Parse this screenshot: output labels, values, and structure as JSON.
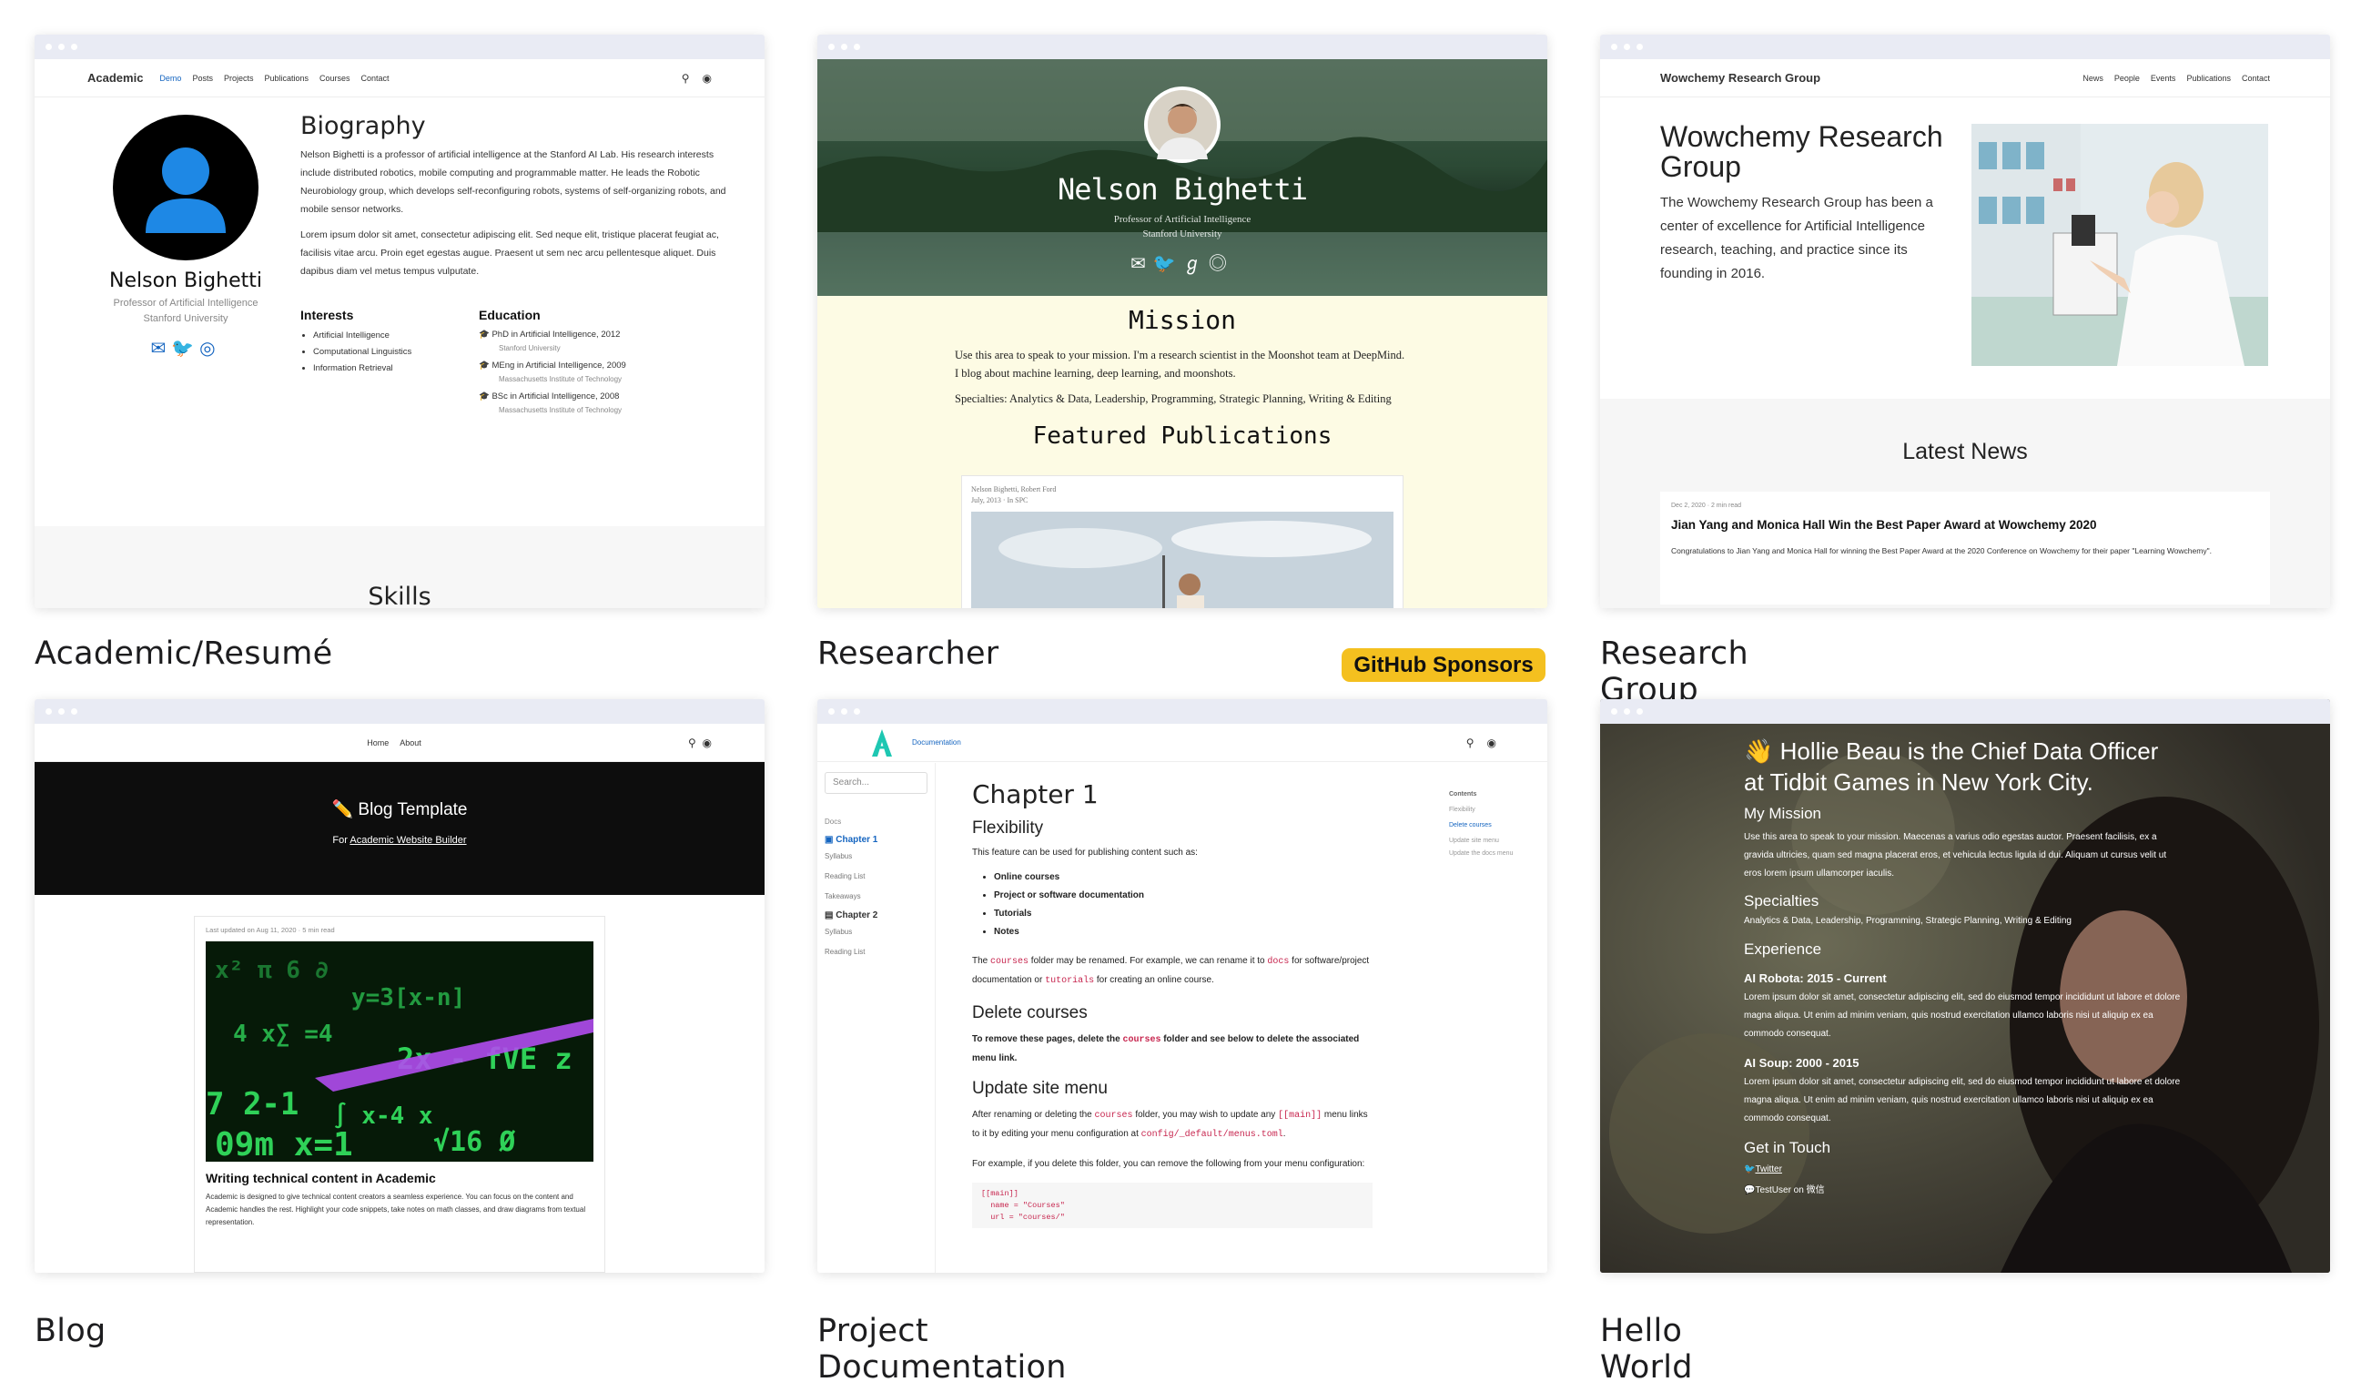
{
  "cards": [
    {
      "caption": "Academic/Resumé",
      "nav": {
        "brand": "Academic",
        "links": [
          "Demo",
          "Posts",
          "Projects",
          "Publications",
          "Courses",
          "Contact"
        ]
      },
      "bio_title": "Biography",
      "name": "Nelson Bighetti",
      "role": "Professor of Artificial Intelligence",
      "org": "Stanford University",
      "bio_p1": "Nelson Bighetti is a professor of artificial intelligence at the Stanford AI Lab. His research interests include distributed robotics, mobile computing and programmable matter. He leads the Robotic Neurobiology group, which develops self-reconfiguring robots, systems of self-organizing robots, and mobile sensor networks.",
      "bio_p2": "Lorem ipsum dolor sit amet, consectetur adipiscing elit. Sed neque elit, tristique placerat feugiat ac, facilisis vitae arcu. Proin eget egestas augue. Praesent ut sem nec arcu pellentesque aliquet. Duis dapibus diam vel metus tempus vulputate.",
      "interests_title": "Interests",
      "interests": [
        "Artificial Intelligence",
        "Computational Linguistics",
        "Information Retrieval"
      ],
      "education_title": "Education",
      "education": [
        {
          "degree": "PhD in Artificial Intelligence, 2012",
          "school": "Stanford University"
        },
        {
          "degree": "MEng in Artificial Intelligence, 2009",
          "school": "Massachusetts Institute of Technology"
        },
        {
          "degree": "BSc in Artificial Intelligence, 2008",
          "school": "Massachusetts Institute of Technology"
        }
      ],
      "skills_title": "Skills"
    },
    {
      "caption": "Researcher",
      "name": "Nelson Bighetti",
      "role": "Professor of Artificial Intelligence",
      "org": "Stanford University",
      "mission_title": "Mission",
      "mission_text": "Use this area to speak to your mission. I'm a research scientist in the Moonshot team at DeepMind. I blog about machine learning, deep learning, and moonshots.",
      "specialties": "Specialties: Analytics & Data, Leadership, Programming, Strategic Planning, Writing & Editing",
      "pubs_title": "Featured Publications",
      "pub_authors": "Nelson Bighetti, Robert Ford",
      "pub_meta": "July, 2013 · In SPC"
    },
    {
      "caption": "Research Group",
      "nav": {
        "brand": "Wowchemy Research Group",
        "links": [
          "News",
          "People",
          "Events",
          "Publications",
          "Contact"
        ]
      },
      "hero_title": "Wowchemy Research Group",
      "hero_text": "The Wowchemy Research Group has been a center of excellence for Artificial Intelligence research, teaching, and practice since its founding in 2016.",
      "news_title": "Latest News",
      "news_meta": "Dec 2, 2020 · 2 min read",
      "news_headline": "Jian Yang and Monica Hall Win the Best Paper Award at Wowchemy 2020",
      "news_text": "Congratulations to Jian Yang and Monica Hall for winning the Best Paper Award at the 2020 Conference on Wowchemy for their paper \"Learning Wowchemy\"."
    },
    {
      "caption": "Blog",
      "nav": {
        "links": [
          "Home",
          "About"
        ]
      },
      "hero_title": "✏️ Blog Template",
      "hero_sub_prefix": "For ",
      "hero_sub_link": "Academic Website Builder",
      "post_meta": "Last updated on Aug 11, 2020 · 5 min read",
      "post_title": "Writing technical content in Academic",
      "post_text": "Academic is designed to give technical content creators a seamless experience. You can focus on the content and Academic handles the rest. Highlight your code snippets, take notes on math classes, and draw diagrams from textual representation."
    },
    {
      "caption": "Project Documentation",
      "nav_link": "Documentation",
      "search_placeholder": "Search...",
      "sidebar": {
        "docs": "Docs",
        "ch1": "Chapter 1",
        "ch1_items": [
          "Syllabus",
          "Reading List",
          "Takeaways"
        ],
        "ch2": "Chapter 2",
        "ch2_items": [
          "Syllabus",
          "Reading List"
        ]
      },
      "toc": {
        "title": "Contents",
        "items": [
          "Flexibility",
          "Delete courses",
          "Update site menu",
          "Update the docs menu"
        ]
      },
      "h1": "Chapter 1",
      "h_flex": "Flexibility",
      "flex_text": "This feature can be used for publishing content such as:",
      "flex_list": [
        "Online courses",
        "Project or software documentation",
        "Tutorials",
        "Notes"
      ],
      "rename_a": "The ",
      "rename_code1": "courses",
      "rename_b": " folder may be renamed. For example, we can rename it to ",
      "rename_code2": "docs",
      "rename_c": " for software/project documentation or ",
      "rename_code3": "tutorials",
      "rename_d": " for creating an online course.",
      "h_delete": "Delete courses",
      "delete_a": "To remove these pages, delete the ",
      "delete_code": "courses",
      "delete_b": " folder and see below to delete the associated menu link.",
      "h_menu": "Update site menu",
      "menu_a": "After renaming or deleting the ",
      "menu_code1": "courses",
      "menu_b": " folder, you may wish to update any ",
      "menu_code2": "[[main]]",
      "menu_c": " menu links to it by editing your menu configuration at ",
      "menu_code3": "config/_default/menus.toml",
      "menu_d": ".",
      "example_text": "For example, if you delete this folder, you can remove the following from your menu configuration:",
      "code_lines": [
        "[[main]]",
        "  name = \"Courses\"",
        "  url = \"courses/\""
      ]
    },
    {
      "caption": "Hello World",
      "headline": "👋 Hollie Beau is the Chief Data Officer at Tidbit Games in New York City.",
      "mission_title": "My Mission",
      "mission_text": "Use this area to speak to your mission. Maecenas a varius odio egestas auctor. Praesent facilisis, ex a gravida ultricies, quam sed magna placerat eros, et vehicula lectus ligula id dui. Aliquam ut cursus velit ut eros lorem ipsum ullamcorper iaculis.",
      "spec_title": "Specialties",
      "spec_text": "Analytics & Data, Leadership, Programming, Strategic Planning, Writing & Editing",
      "exp_title": "Experience",
      "job1": "AI Robota: 2015 - Current",
      "job1_text": "Lorem ipsum dolor sit amet, consectetur adipiscing elit, sed do eiusmod tempor incididunt ut labore et dolore magna aliqua. Ut enim ad minim veniam, quis nostrud exercitation ullamco laboris nisi ut aliquip ex ea commodo consequat.",
      "job2": "AI Soup: 2000 - 2015",
      "job2_text": "Lorem ipsum dolor sit amet, consectetur adipiscing elit, sed do eiusmod tempor incididunt ut labore et dolore magna aliqua. Ut enim ad minim veniam, quis nostrud exercitation ullamco laboris nisi ut aliquip ex ea commodo consequat.",
      "touch_title": "Get in Touch",
      "twitter": "Twitter",
      "wechat": "TestUser on 微信"
    }
  ],
  "badge": "GitHub Sponsors",
  "colors": {
    "accent": "#1565c0",
    "badge": "#f4c01f",
    "chrome": "#e9ebf4"
  }
}
